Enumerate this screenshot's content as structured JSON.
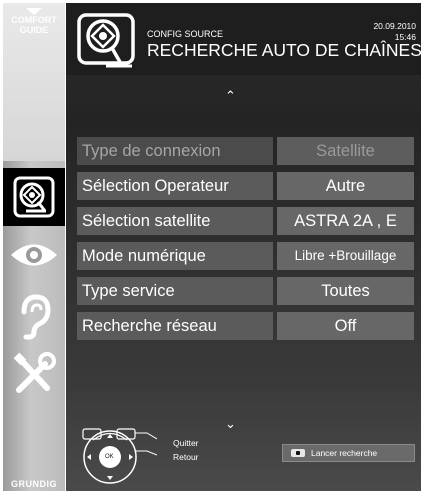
{
  "sidebar": {
    "comfort_guide": "COMFORT\nGUIDE",
    "comfort_line1": "COMFORT",
    "comfort_line2": "GUIDE",
    "icons": [
      "satellite-dish-icon",
      "eye-icon",
      "ear-icon",
      "tools-icon"
    ],
    "brand": "GRUNDIG"
  },
  "header": {
    "section": "CONFIG SOURCE",
    "title": "RECHERCHE AUTO DE CHAÎNES",
    "date": "20.09.2010",
    "time": "15:46"
  },
  "settings": [
    {
      "label": "Type de connexion",
      "value": "Satellite",
      "state": "disabled"
    },
    {
      "label": "Sélection Operateur",
      "value": "Autre",
      "state": "normal"
    },
    {
      "label": "Sélection satellite",
      "value": "ASTRA 2A , E",
      "state": "normal"
    },
    {
      "label": "Mode numérique",
      "value": "Libre +Brouillage",
      "state": "normal"
    },
    {
      "label": "Type service",
      "value": "Toutes",
      "state": "normal"
    },
    {
      "label": "Recherche réseau",
      "value": "Off",
      "state": "normal"
    }
  ],
  "footer": {
    "ok_label": "OK",
    "quit_label": "Quitter",
    "back_label": "Retour",
    "launch_label": "Lancer recherche"
  },
  "colors": {
    "panel": "#2c2c2c",
    "row_label": "#5b5b5b",
    "row_value": "#676767",
    "disabled_text": "#a6a6a6",
    "sidebar": "#c8c8c8"
  }
}
